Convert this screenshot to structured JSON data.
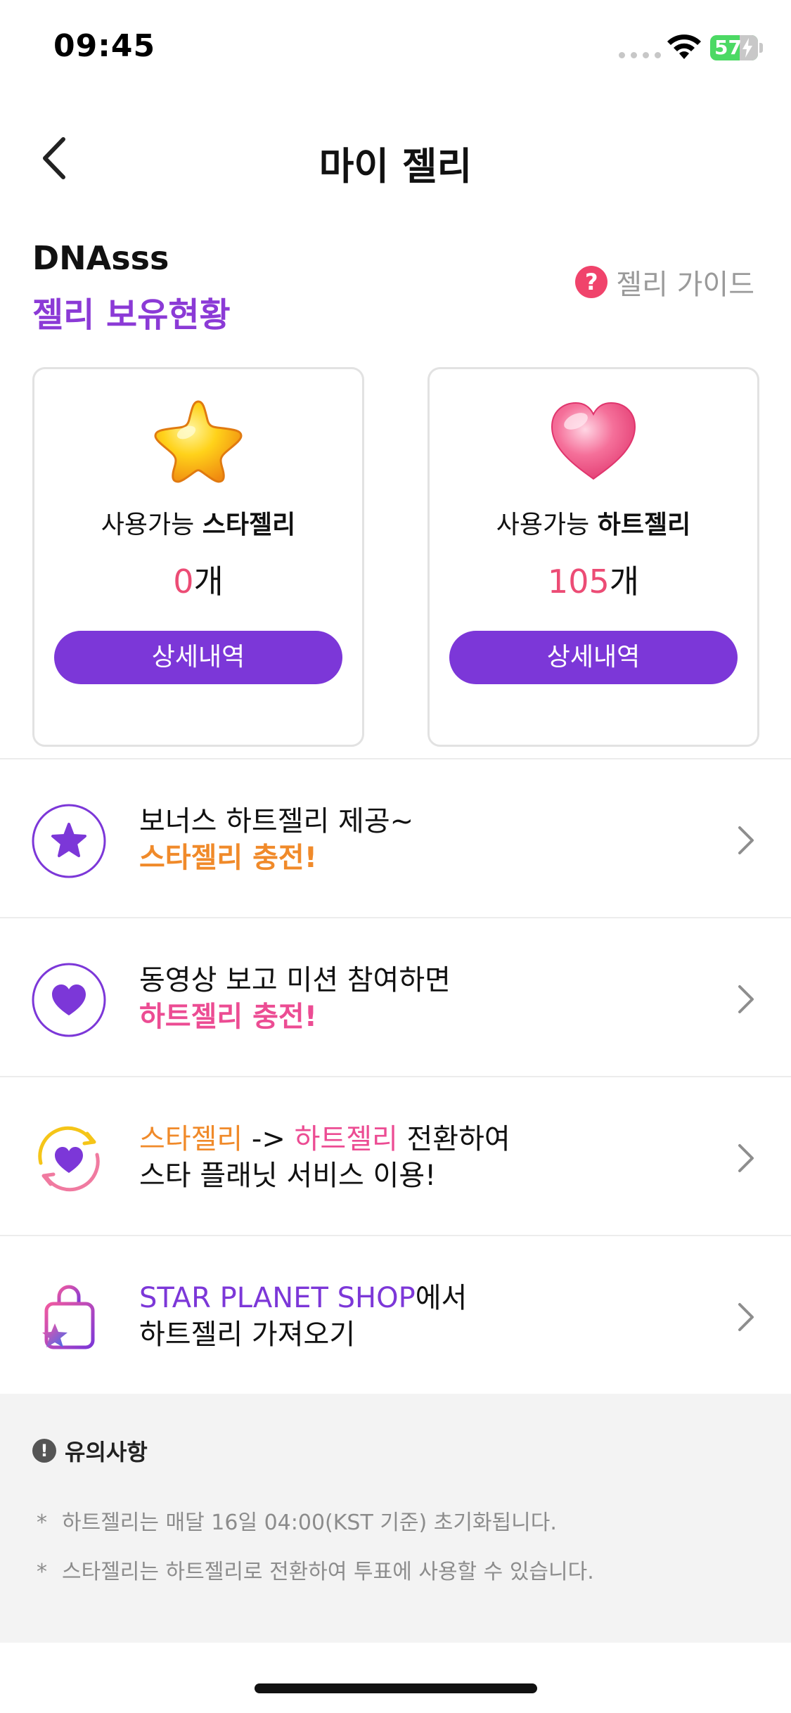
{
  "status_bar": {
    "time": "09:45",
    "battery": "57"
  },
  "nav": {
    "title": "마이 젤리"
  },
  "user": {
    "name": "DNAsss",
    "holding_title": "젤리 보유현황",
    "guide_label": "젤리 가이드"
  },
  "cards": [
    {
      "label_prefix": "사용가능 ",
      "label_bold": "스타젤리",
      "count": "0",
      "unit": "개",
      "button": "상세내역"
    },
    {
      "label_prefix": "사용가능 ",
      "label_bold": "하트젤리",
      "count": "105",
      "unit": "개",
      "button": "상세내역"
    }
  ],
  "menu": [
    {
      "line1": "보너스 하트젤리 제공~",
      "line2": "스타젤리 충전!",
      "icon": "star-icon"
    },
    {
      "line1": "동영상 보고 미션 참여하면",
      "line2": "하트젤리 충전!",
      "icon": "heart-icon"
    },
    {
      "line1_a": "스타젤리",
      "line1_b": " -> ",
      "line1_c": "하트젤리",
      "line1_d": " 전환하여",
      "line2": "스타 플래닛 서비스 이용!",
      "icon": "exchange-icon"
    },
    {
      "line1_a": "STAR PLANET SHOP",
      "line1_b": "에서",
      "line2": "하트젤리 가져오기",
      "icon": "shopping-bag-icon"
    }
  ],
  "notice": {
    "title": "유의사항",
    "items": [
      "하트젤리는 매달 16일 04:00(KST 기준) 초기화됩니다.",
      "스타젤리는 하트젤리로 전환하여 투표에 사용할 수 있습니다."
    ],
    "bullet": "*"
  },
  "colors": {
    "accent": "#7c37d8",
    "pink": "#ec4c75",
    "orange": "#f08a2a"
  }
}
